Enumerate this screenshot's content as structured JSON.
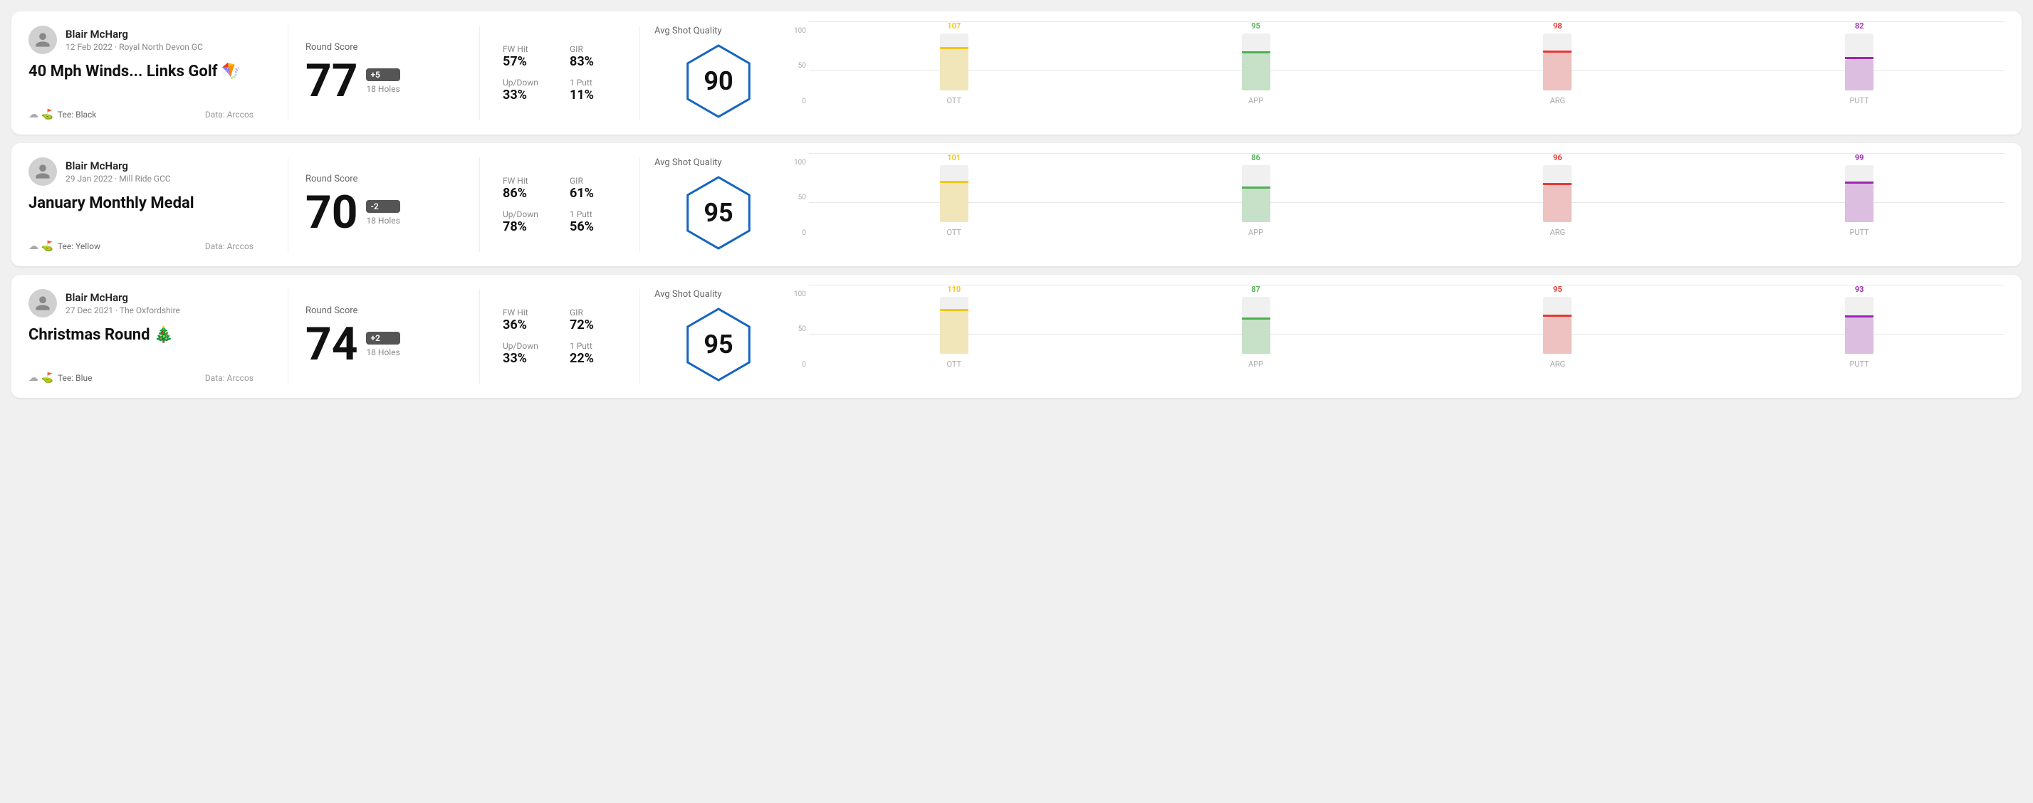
{
  "cards": [
    {
      "id": "card1",
      "user": {
        "name": "Blair McHarg",
        "date": "12 Feb 2022 · Royal North Devon GC"
      },
      "title": "40 Mph Winds... Links Golf",
      "title_emoji": "🪁",
      "tee": "Black",
      "data_source": "Data: Arccos",
      "round_score_label": "Round Score",
      "score": "77",
      "score_badge": "+5",
      "score_holes": "18 Holes",
      "fw_hit_label": "FW Hit",
      "fw_hit_value": "57%",
      "gir_label": "GIR",
      "gir_value": "83%",
      "updown_label": "Up/Down",
      "updown_value": "33%",
      "one_putt_label": "1 Putt",
      "one_putt_value": "11%",
      "avg_shot_quality_label": "Avg Shot Quality",
      "quality_score": "90",
      "bars": [
        {
          "label": "OTT",
          "value": 107,
          "color": "#f5c518",
          "bar_pct": 72
        },
        {
          "label": "APP",
          "value": 95,
          "color": "#4caf50",
          "bar_pct": 64
        },
        {
          "label": "ARG",
          "value": 98,
          "color": "#e53935",
          "bar_pct": 66
        },
        {
          "label": "PUTT",
          "value": 82,
          "color": "#9c27b0",
          "bar_pct": 55
        }
      ]
    },
    {
      "id": "card2",
      "user": {
        "name": "Blair McHarg",
        "date": "29 Jan 2022 · Mill Ride GCC"
      },
      "title": "January Monthly Medal",
      "title_emoji": "",
      "tee": "Yellow",
      "data_source": "Data: Arccos",
      "round_score_label": "Round Score",
      "score": "70",
      "score_badge": "-2",
      "score_holes": "18 Holes",
      "fw_hit_label": "FW Hit",
      "fw_hit_value": "86%",
      "gir_label": "GIR",
      "gir_value": "61%",
      "updown_label": "Up/Down",
      "updown_value": "78%",
      "one_putt_label": "1 Putt",
      "one_putt_value": "56%",
      "avg_shot_quality_label": "Avg Shot Quality",
      "quality_score": "95",
      "bars": [
        {
          "label": "OTT",
          "value": 101,
          "color": "#f5c518",
          "bar_pct": 68
        },
        {
          "label": "APP",
          "value": 86,
          "color": "#4caf50",
          "bar_pct": 58
        },
        {
          "label": "ARG",
          "value": 96,
          "color": "#e53935",
          "bar_pct": 65
        },
        {
          "label": "PUTT",
          "value": 99,
          "color": "#9c27b0",
          "bar_pct": 67
        }
      ]
    },
    {
      "id": "card3",
      "user": {
        "name": "Blair McHarg",
        "date": "27 Dec 2021 · The Oxfordshire"
      },
      "title": "Christmas Round",
      "title_emoji": "🎄",
      "tee": "Blue",
      "data_source": "Data: Arccos",
      "round_score_label": "Round Score",
      "score": "74",
      "score_badge": "+2",
      "score_holes": "18 Holes",
      "fw_hit_label": "FW Hit",
      "fw_hit_value": "36%",
      "gir_label": "GIR",
      "gir_value": "72%",
      "updown_label": "Up/Down",
      "updown_value": "33%",
      "one_putt_label": "1 Putt",
      "one_putt_value": "22%",
      "avg_shot_quality_label": "Avg Shot Quality",
      "quality_score": "95",
      "bars": [
        {
          "label": "OTT",
          "value": 110,
          "color": "#f5c518",
          "bar_pct": 74
        },
        {
          "label": "APP",
          "value": 87,
          "color": "#4caf50",
          "bar_pct": 59
        },
        {
          "label": "ARG",
          "value": 95,
          "color": "#e53935",
          "bar_pct": 64
        },
        {
          "label": "PUTT",
          "value": 93,
          "color": "#9c27b0",
          "bar_pct": 63
        }
      ]
    }
  ]
}
